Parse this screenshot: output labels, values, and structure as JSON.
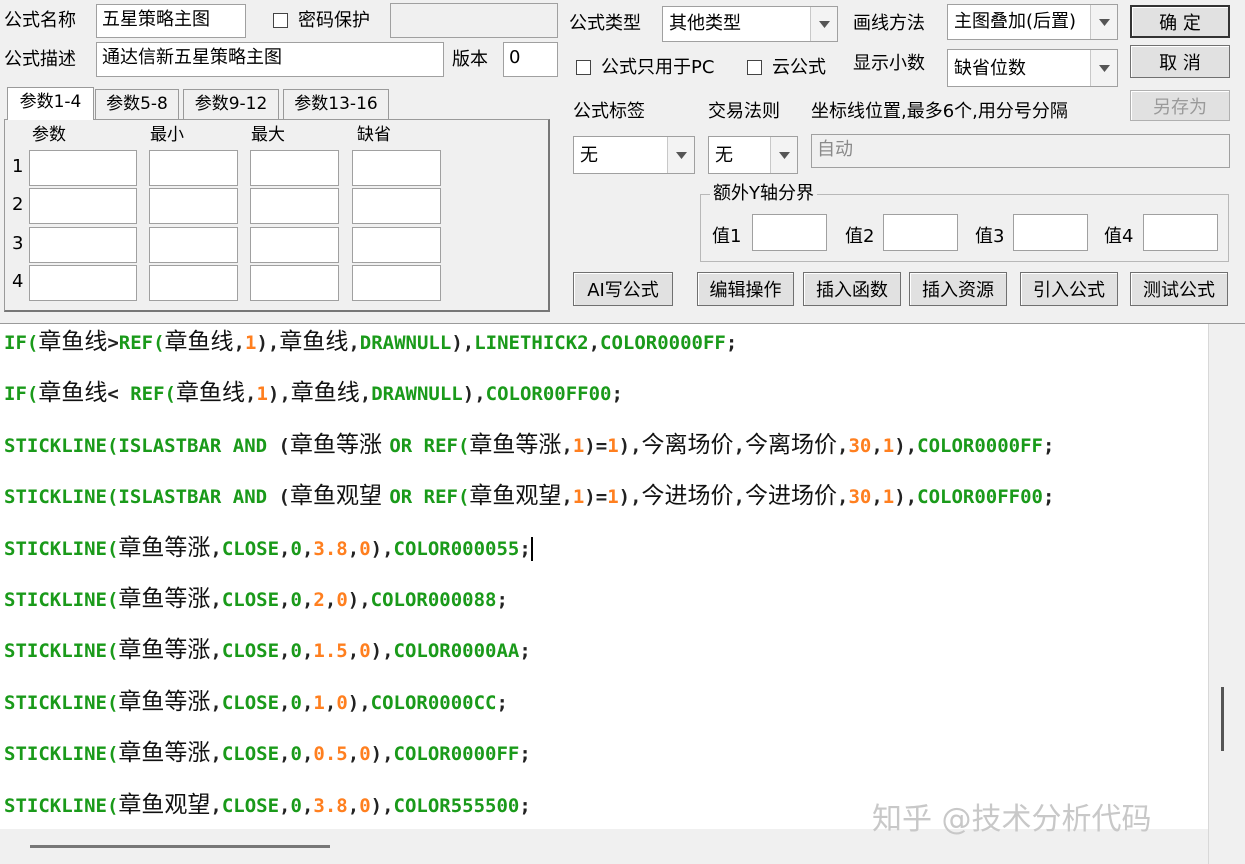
{
  "form": {
    "name_label": "公式名称",
    "name_value": "五星策略主图",
    "password_label": "密码保护",
    "type_label": "公式类型",
    "type_value": "其他类型",
    "draw_label": "画线方法",
    "draw_value": "主图叠加(后置)",
    "ok_label": "确 定",
    "desc_label": "公式描述",
    "desc_value": "通达信新五星策略主图",
    "version_label": "版本",
    "version_value": "0",
    "pc_only_label": "公式只用于PC",
    "cloud_label": "云公式",
    "decimals_label": "显示小数",
    "decimals_value": "缺省位数",
    "cancel_label": "取 消",
    "save_as_label": "另存为",
    "tag_label": "公式标签",
    "tag_value": "无",
    "trade_label": "交易法则",
    "trade_value": "无",
    "coord_label": "坐标线位置,最多6个,用分号分隔",
    "coord_value": "自动",
    "yaxis_group_label": "额外Y轴分界",
    "yaxis_labels": [
      "值1",
      "值2",
      "值3",
      "值4"
    ]
  },
  "tabs": [
    "参数1-4",
    "参数5-8",
    "参数9-12",
    "参数13-16"
  ],
  "params": {
    "headers": [
      "参数",
      "最小",
      "最大",
      "缺省"
    ],
    "rows": [
      "1",
      "2",
      "3",
      "4"
    ]
  },
  "actions": [
    "AI写公式",
    "编辑操作",
    "插入函数",
    "插入资源",
    "引入公式",
    "测试公式"
  ],
  "code_lines": [
    [
      [
        "k",
        "IF("
      ],
      [
        "cjk",
        "章鱼线"
      ],
      [
        "p",
        ">"
      ],
      [
        "k",
        "REF("
      ],
      [
        "cjk",
        "章鱼线"
      ],
      [
        "p",
        ","
      ],
      [
        "n",
        "1"
      ],
      [
        "p",
        "),"
      ],
      [
        "cjk",
        "章鱼线"
      ],
      [
        "p",
        ","
      ],
      [
        "k",
        "DRAWNULL"
      ],
      [
        "p",
        "),"
      ],
      [
        "k",
        "LINETHICK2"
      ],
      [
        "p",
        ","
      ],
      [
        "c",
        "COLOR0000FF"
      ],
      [
        "p",
        ";"
      ]
    ],
    [
      [
        "k",
        "IF("
      ],
      [
        "cjk",
        "章鱼线"
      ],
      [
        "p",
        "< "
      ],
      [
        "k",
        "REF("
      ],
      [
        "cjk",
        "章鱼线"
      ],
      [
        "p",
        ","
      ],
      [
        "n",
        "1"
      ],
      [
        "p",
        "),"
      ],
      [
        "cjk",
        "章鱼线"
      ],
      [
        "p",
        ","
      ],
      [
        "k",
        "DRAWNULL"
      ],
      [
        "p",
        "),"
      ],
      [
        "c",
        "COLOR00FF00"
      ],
      [
        "p",
        ";"
      ]
    ],
    [
      [
        "k",
        "STICKLINE(ISLASTBAR AND "
      ],
      [
        "p",
        "("
      ],
      [
        "cjk",
        "章鱼等涨 "
      ],
      [
        "k",
        "OR REF("
      ],
      [
        "cjk",
        "章鱼等涨"
      ],
      [
        "p",
        ","
      ],
      [
        "n",
        "1"
      ],
      [
        "p",
        ")="
      ],
      [
        "n",
        "1"
      ],
      [
        "p",
        "),"
      ],
      [
        "cjk",
        "今离场价"
      ],
      [
        "p",
        ","
      ],
      [
        "cjk",
        "今离场价"
      ],
      [
        "p",
        ","
      ],
      [
        "n",
        "30"
      ],
      [
        "p",
        ","
      ],
      [
        "n",
        "1"
      ],
      [
        "p",
        "),"
      ],
      [
        "c",
        "COLOR0000FF"
      ],
      [
        "p",
        ";"
      ]
    ],
    [
      [
        "k",
        "STICKLINE(ISLASTBAR AND "
      ],
      [
        "p",
        "("
      ],
      [
        "cjk",
        "章鱼观望 "
      ],
      [
        "k",
        "OR REF("
      ],
      [
        "cjk",
        "章鱼观望"
      ],
      [
        "p",
        ","
      ],
      [
        "n",
        "1"
      ],
      [
        "p",
        ")="
      ],
      [
        "n",
        "1"
      ],
      [
        "p",
        "),"
      ],
      [
        "cjk",
        "今进场价"
      ],
      [
        "p",
        ","
      ],
      [
        "cjk",
        "今进场价"
      ],
      [
        "p",
        ","
      ],
      [
        "n",
        "30"
      ],
      [
        "p",
        ","
      ],
      [
        "n",
        "1"
      ],
      [
        "p",
        "),"
      ],
      [
        "c",
        "COLOR00FF00"
      ],
      [
        "p",
        ";"
      ]
    ],
    [
      [
        "k",
        "STICKLINE("
      ],
      [
        "cjk",
        "章鱼等涨"
      ],
      [
        "p",
        ","
      ],
      [
        "k",
        "CLOSE"
      ],
      [
        "p",
        ","
      ],
      [
        "k",
        "0"
      ],
      [
        "p",
        ","
      ],
      [
        "n",
        "3.8"
      ],
      [
        "p",
        ","
      ],
      [
        "n",
        "0"
      ],
      [
        "p",
        "),"
      ],
      [
        "c",
        "COLOR000055"
      ],
      [
        "p",
        ";"
      ]
    ],
    [
      [
        "k",
        "STICKLINE("
      ],
      [
        "cjk",
        "章鱼等涨"
      ],
      [
        "p",
        ","
      ],
      [
        "k",
        "CLOSE"
      ],
      [
        "p",
        ","
      ],
      [
        "k",
        "0"
      ],
      [
        "p",
        ","
      ],
      [
        "n",
        "2"
      ],
      [
        "p",
        ","
      ],
      [
        "n",
        "0"
      ],
      [
        "p",
        "),"
      ],
      [
        "c",
        "COLOR000088"
      ],
      [
        "p",
        ";"
      ]
    ],
    [
      [
        "k",
        "STICKLINE("
      ],
      [
        "cjk",
        "章鱼等涨"
      ],
      [
        "p",
        ","
      ],
      [
        "k",
        "CLOSE"
      ],
      [
        "p",
        ","
      ],
      [
        "k",
        "0"
      ],
      [
        "p",
        ","
      ],
      [
        "n",
        "1.5"
      ],
      [
        "p",
        ","
      ],
      [
        "n",
        "0"
      ],
      [
        "p",
        "),"
      ],
      [
        "c",
        "COLOR0000AA"
      ],
      [
        "p",
        ";"
      ]
    ],
    [
      [
        "k",
        "STICKLINE("
      ],
      [
        "cjk",
        "章鱼等涨"
      ],
      [
        "p",
        ","
      ],
      [
        "k",
        "CLOSE"
      ],
      [
        "p",
        ","
      ],
      [
        "k",
        "0"
      ],
      [
        "p",
        ","
      ],
      [
        "n",
        "1"
      ],
      [
        "p",
        ","
      ],
      [
        "n",
        "0"
      ],
      [
        "p",
        "),"
      ],
      [
        "c",
        "COLOR0000CC"
      ],
      [
        "p",
        ";"
      ]
    ],
    [
      [
        "k",
        "STICKLINE("
      ],
      [
        "cjk",
        "章鱼等涨"
      ],
      [
        "p",
        ","
      ],
      [
        "k",
        "CLOSE"
      ],
      [
        "p",
        ","
      ],
      [
        "k",
        "0"
      ],
      [
        "p",
        ","
      ],
      [
        "n",
        "0.5"
      ],
      [
        "p",
        ","
      ],
      [
        "n",
        "0"
      ],
      [
        "p",
        "),"
      ],
      [
        "c",
        "COLOR0000FF"
      ],
      [
        "p",
        ";"
      ]
    ],
    [
      [
        "k",
        "STICKLINE("
      ],
      [
        "cjk",
        "章鱼观望"
      ],
      [
        "p",
        ","
      ],
      [
        "k",
        "CLOSE"
      ],
      [
        "p",
        ","
      ],
      [
        "k",
        "0"
      ],
      [
        "p",
        ","
      ],
      [
        "n",
        "3.8"
      ],
      [
        "p",
        ","
      ],
      [
        "n",
        "0"
      ],
      [
        "p",
        "),"
      ],
      [
        "c",
        "COLOR555500"
      ],
      [
        "p",
        ";"
      ]
    ]
  ],
  "caret_line": 4,
  "watermark": "知乎 @技术分析代码"
}
